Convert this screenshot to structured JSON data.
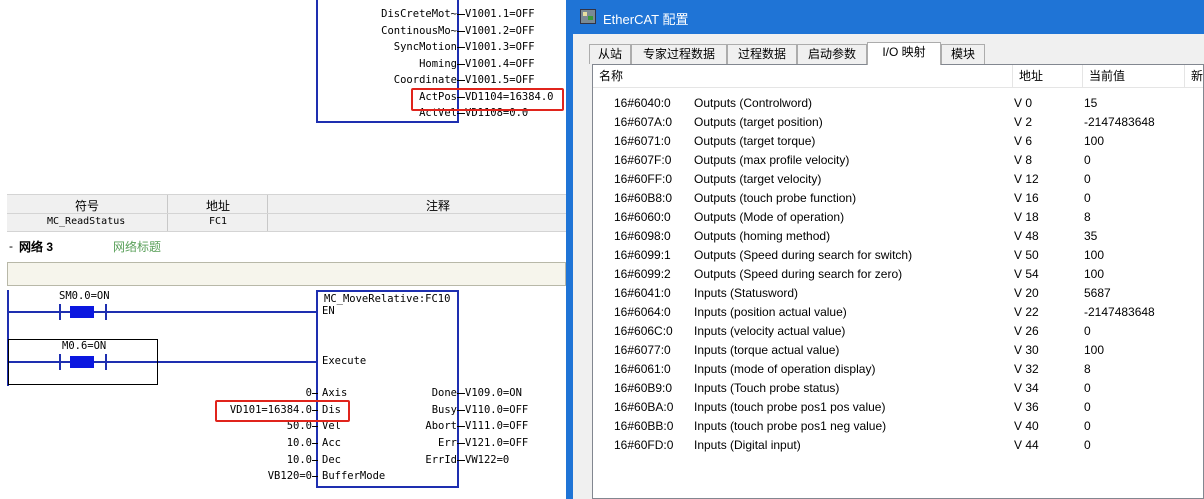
{
  "ladder": {
    "status_block": {
      "pins": [
        {
          "name": "DisCreteMot~",
          "value": "V1001.1=OFF"
        },
        {
          "name": "ContinousMo~",
          "value": "V1001.2=OFF"
        },
        {
          "name": "SyncMotion",
          "value": "V1001.3=OFF"
        },
        {
          "name": "Homing",
          "value": "V1001.4=OFF"
        },
        {
          "name": "Coordinate",
          "value": "V1001.5=OFF"
        },
        {
          "name": "ActPos",
          "value": "VD1104=16384.0"
        },
        {
          "name": "ActVel",
          "value": "VD1108=0.0"
        }
      ]
    },
    "symbol_table": {
      "headers": [
        "符号",
        "地址",
        "注释"
      ],
      "rows": [
        {
          "symbol": "MC_ReadStatus",
          "address": "FC1",
          "comment": ""
        }
      ]
    },
    "network": {
      "toggle": "-",
      "label": "网络 3",
      "title": "网络标题"
    },
    "contacts": [
      {
        "label": "SM0.0=ON"
      },
      {
        "label": "M0.6=ON"
      }
    ],
    "move_block": {
      "title": "MC_MoveRelative:FC10",
      "inputs": [
        {
          "name": "EN",
          "value": ""
        },
        {
          "name": "Execute",
          "value": ""
        },
        {
          "name": "Axis",
          "value": "0"
        },
        {
          "name": "Dis",
          "value": "VD101=16384.0"
        },
        {
          "name": "Vel",
          "value": "50.0"
        },
        {
          "name": "Acc",
          "value": "10.0"
        },
        {
          "name": "Dec",
          "value": "10.0"
        },
        {
          "name": "BufferMode",
          "value": "VB120=0"
        }
      ],
      "outputs": [
        {
          "name": "Done",
          "value": "V109.0=ON"
        },
        {
          "name": "Busy",
          "value": "V110.0=OFF"
        },
        {
          "name": "Abort",
          "value": "V111.0=OFF"
        },
        {
          "name": "Err",
          "value": "V121.0=OFF"
        },
        {
          "name": "ErrId",
          "value": "VW122=0"
        }
      ]
    },
    "colors": {
      "wire": "#1e2fb0",
      "contact": "#0b17e0",
      "highlight": "#e0241c"
    }
  },
  "ethercat": {
    "window_title": "EtherCAT 配置",
    "tabs": [
      "从站",
      "专家过程数据",
      "过程数据",
      "启动参数",
      "I/O 映射",
      "模块"
    ],
    "active_tab": "I/O 映射",
    "columns": [
      "名称",
      "地址",
      "当前值",
      "新"
    ],
    "rows": [
      {
        "index": "16#6040:0",
        "name": "Outputs (Controlword)",
        "address": "V 0",
        "value": "15"
      },
      {
        "index": "16#607A:0",
        "name": "Outputs (target position)",
        "address": "V 2",
        "value": "-2147483648"
      },
      {
        "index": "16#6071:0",
        "name": "Outputs (target torque)",
        "address": "V 6",
        "value": "100"
      },
      {
        "index": "16#607F:0",
        "name": "Outputs (max profile velocity)",
        "address": "V 8",
        "value": "0"
      },
      {
        "index": "16#60FF:0",
        "name": "Outputs (target velocity)",
        "address": "V 12",
        "value": "0"
      },
      {
        "index": "16#60B8:0",
        "name": "Outputs (touch probe function)",
        "address": "V 16",
        "value": "0"
      },
      {
        "index": "16#6060:0",
        "name": "Outputs (Mode of operation)",
        "address": "V 18",
        "value": "8"
      },
      {
        "index": "16#6098:0",
        "name": "Outputs (homing method)",
        "address": "V 48",
        "value": "35"
      },
      {
        "index": "16#6099:1",
        "name": "Outputs (Speed during search for switch)",
        "address": "V 50",
        "value": "100"
      },
      {
        "index": "16#6099:2",
        "name": "Outputs (Speed during search for zero)",
        "address": "V 54",
        "value": "100"
      },
      {
        "index": "16#6041:0",
        "name": "Inputs (Statusword)",
        "address": "V 20",
        "value": "5687"
      },
      {
        "index": "16#6064:0",
        "name": "Inputs (position actual value)",
        "address": "V 22",
        "value": "-2147483648"
      },
      {
        "index": "16#606C:0",
        "name": "Inputs (velocity actual value)",
        "address": "V 26",
        "value": "0"
      },
      {
        "index": "16#6077:0",
        "name": "Inputs (torque actual value)",
        "address": "V 30",
        "value": "100"
      },
      {
        "index": "16#6061:0",
        "name": "Inputs (mode of operation display)",
        "address": "V 32",
        "value": "8"
      },
      {
        "index": "16#60B9:0",
        "name": "Inputs (Touch probe status)",
        "address": "V 34",
        "value": "0"
      },
      {
        "index": "16#60BA:0",
        "name": "Inputs (touch probe pos1 pos value)",
        "address": "V 36",
        "value": "0"
      },
      {
        "index": "16#60BB:0",
        "name": "Inputs (touch probe pos1 neg value)",
        "address": "V 40",
        "value": "0"
      },
      {
        "index": "16#60FD:0",
        "name": "Inputs (Digital input)",
        "address": "V 44",
        "value": "0"
      }
    ],
    "colors": {
      "titlebar": "#1f74d6",
      "body": "#f0f0f0"
    }
  }
}
